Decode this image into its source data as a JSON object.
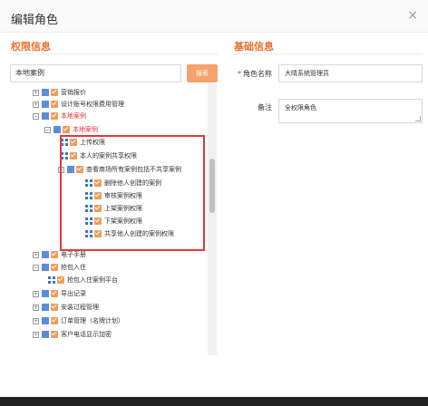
{
  "dialog": {
    "title": "编辑角色",
    "close_icon": "×"
  },
  "permissions": {
    "section_title": "权限信息",
    "search_value": "本地案例",
    "search_button": "搜索",
    "tree": [
      {
        "label": "营销报价",
        "toggle": "+",
        "icon": "folder",
        "red": false
      },
      {
        "label": "设计账号权限费用管理",
        "toggle": "+",
        "icon": "folder",
        "red": false
      },
      {
        "label": "本地案例",
        "toggle": "−",
        "icon": "folder",
        "red": true
      },
      {
        "label": "本地案例",
        "toggle": "−",
        "icon": "folder",
        "red": true
      },
      {
        "label": "上传权限",
        "toggle": "",
        "icon": "grid",
        "red": false
      },
      {
        "label": "本人的案例共享权限",
        "toggle": "",
        "icon": "grid",
        "red": false
      },
      {
        "label": "查看商场所有案例包括不共享案例",
        "toggle": "−",
        "icon": "folder",
        "red": false
      },
      {
        "label": "删除他人创建的案例",
        "toggle": "",
        "icon": "grid",
        "red": false
      },
      {
        "label": "审核案例权限",
        "toggle": "",
        "icon": "grid",
        "red": false
      },
      {
        "label": "上架案例权限",
        "toggle": "",
        "icon": "grid",
        "red": false
      },
      {
        "label": "下架案例权限",
        "toggle": "",
        "icon": "grid",
        "red": false
      },
      {
        "label": "共享他人创建的案例权限",
        "toggle": "",
        "icon": "grid",
        "red": false
      },
      {
        "label": "电子手册",
        "toggle": "+",
        "icon": "folder",
        "red": false
      },
      {
        "label": "抢包入住",
        "toggle": "−",
        "icon": "folder",
        "red": false
      },
      {
        "label": "抢包入住案例平台",
        "toggle": "",
        "icon": "grid",
        "red": false
      },
      {
        "label": "导出记录",
        "toggle": "+",
        "icon": "folder",
        "red": false
      },
      {
        "label": "安装过程管理",
        "toggle": "+",
        "icon": "folder",
        "red": false
      },
      {
        "label": "订单管理（名牌计划）",
        "toggle": "+",
        "icon": "folder",
        "red": false
      },
      {
        "label": "客户电话显示加密",
        "toggle": "+",
        "icon": "folder",
        "red": false
      }
    ]
  },
  "basic": {
    "section_title": "基础信息",
    "required_mark": "*",
    "role_name_label": "角色名称",
    "role_name_value": "大晴系统管理员",
    "remark_label": "备注",
    "remark_value": "全权限角色"
  },
  "colors": {
    "accent": "#e8712a",
    "highlight": "#e03a3a",
    "checkbox": "#f29b5b"
  }
}
